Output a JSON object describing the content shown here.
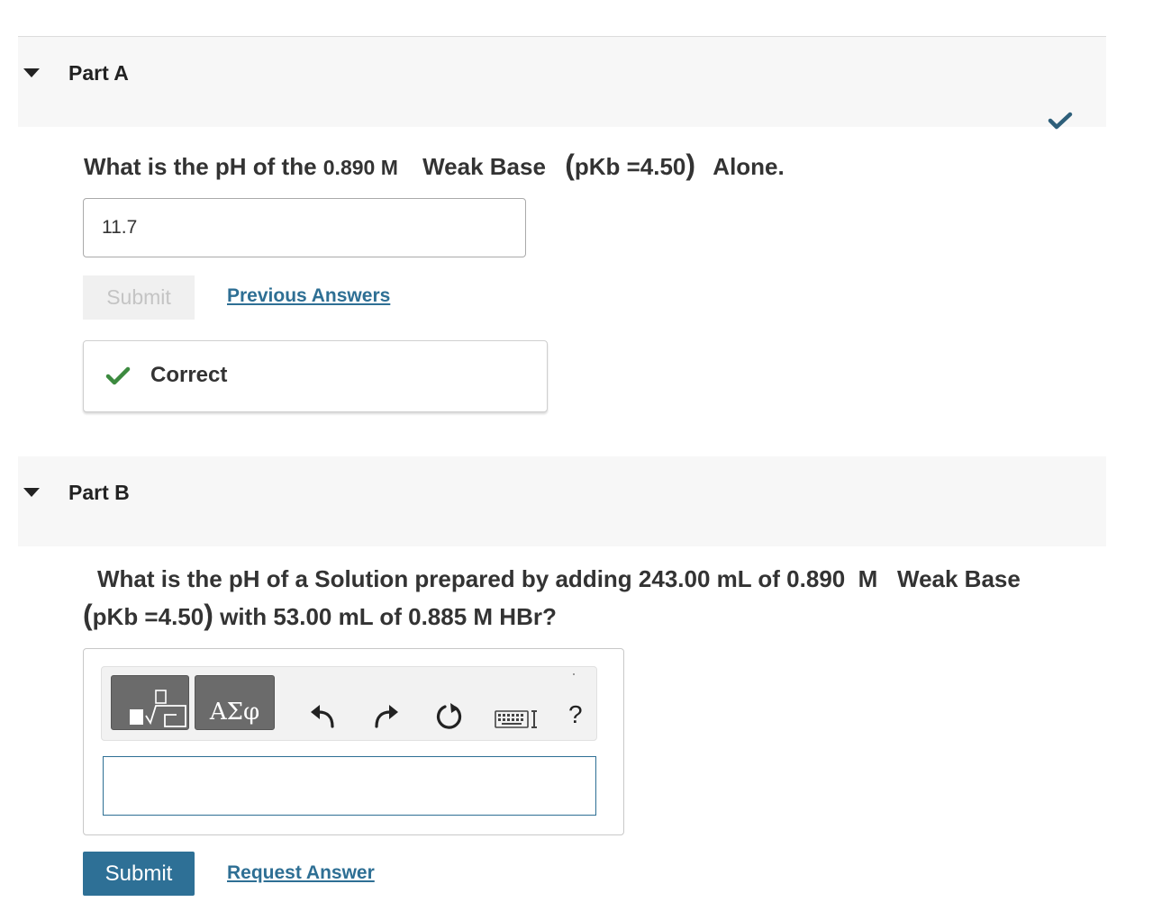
{
  "partA": {
    "title": "Part A",
    "question": {
      "prefix": "What is the pH of the ",
      "concentration": "0.890 M",
      "base": "Weak Base",
      "pkb": "pKb =4.50",
      "suffix": "Alone."
    },
    "answer_value": "11.7",
    "submit_label": "Submit",
    "previous_answers_label": "Previous Answers",
    "feedback_label": "Correct"
  },
  "partB": {
    "title": "Part B",
    "question": {
      "line1": "What is the pH of a Solution prepared by adding 243.00 mL of 0.890  M   Weak Base",
      "pkb": "pKb =4.50",
      "line2_rest": "with 53.00 mL of 0.885 M HBr?"
    },
    "toolbar": {
      "greek_label": "ΑΣφ",
      "help_label": "?"
    },
    "answer_value": "",
    "submit_label": "Submit",
    "request_answer_label": "Request Answer"
  },
  "colors": {
    "accent": "#2e7096",
    "link": "#2e6f94",
    "correct_green": "#3c8a3f",
    "header_bg": "#f7f7f7"
  }
}
